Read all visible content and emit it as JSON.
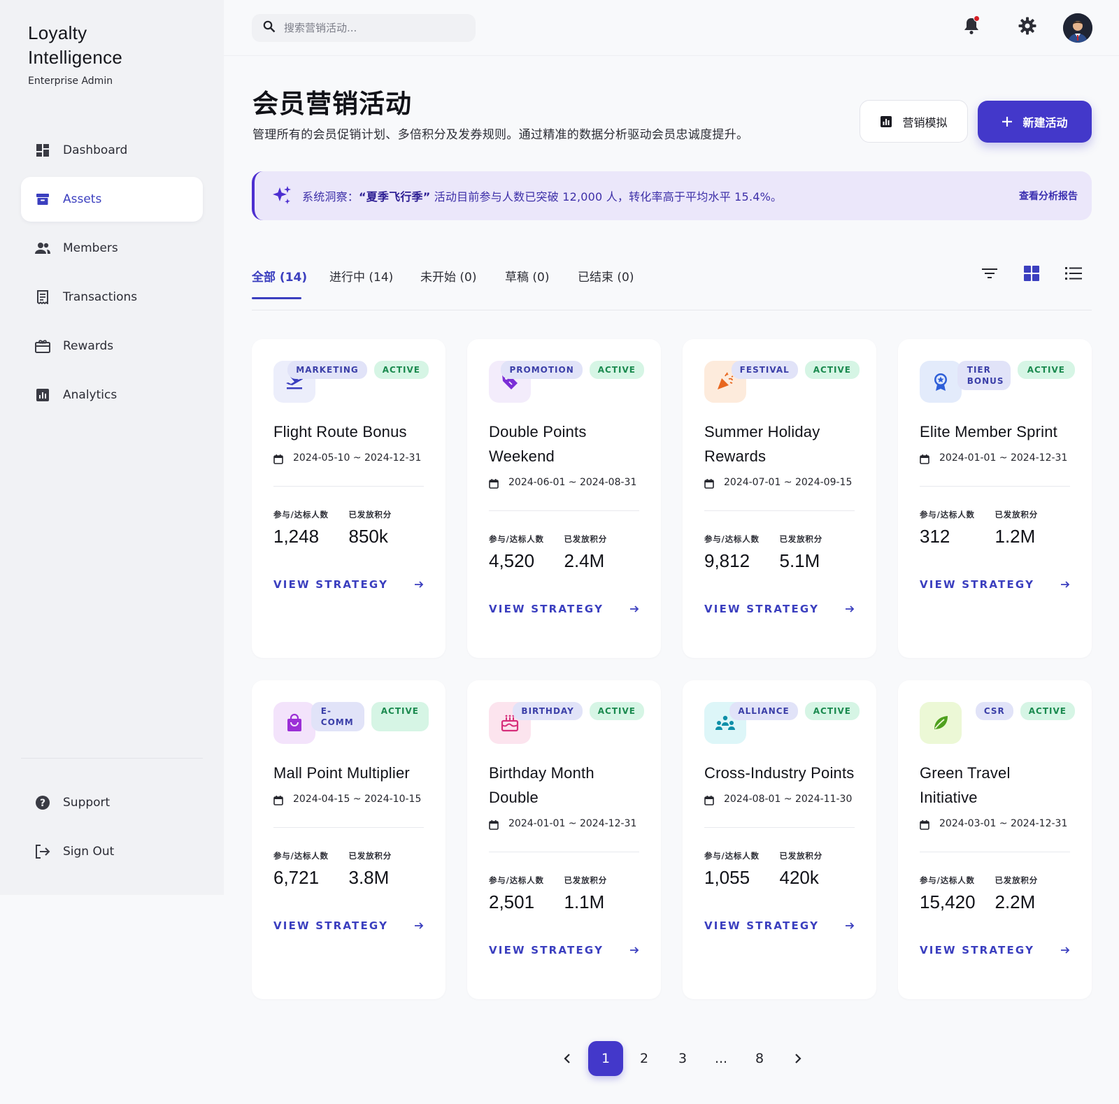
{
  "brand": {
    "title_line1": "Loyalty",
    "title_line2": "Intelligence",
    "subtitle": "Enterprise Admin"
  },
  "nav": {
    "items": [
      {
        "label": "Dashboard",
        "icon": "dashboard-icon"
      },
      {
        "label": "Assets",
        "icon": "archive-icon",
        "active": true
      },
      {
        "label": "Members",
        "icon": "people-icon"
      },
      {
        "label": "Transactions",
        "icon": "receipt-icon"
      },
      {
        "label": "Rewards",
        "icon": "gift-card-icon"
      },
      {
        "label": "Analytics",
        "icon": "bar-chart-icon"
      }
    ],
    "bottom": [
      {
        "label": "Support",
        "icon": "help-icon"
      },
      {
        "label": "Sign Out",
        "icon": "logout-icon"
      }
    ]
  },
  "topbar": {
    "search_placeholder": "搜索营销活动..."
  },
  "header": {
    "title": "会员营销活动",
    "subtitle": "管理所有的会员促销计划、多倍积分及发券规则。通过精准的数据分析驱动会员忠诚度提升。",
    "sim_button": "营销模拟",
    "new_button": "新建活动"
  },
  "insight": {
    "prefix": "系统洞察：",
    "highlight": "“夏季飞行季”",
    "suffix": " 活动目前参与人数已突破 12,000 人，转化率高于平均水平 15.4%。",
    "link": "查看分析报告"
  },
  "tabs": [
    "全部 (14)",
    "进行中 (14)",
    "未开始 (0)",
    "草稿 (0)",
    "已结束 (0)"
  ],
  "stat_labels": {
    "participants": "参与/达标人数",
    "points": "已发放积分"
  },
  "view_strategy": "VIEW STRATEGY",
  "cards": [
    {
      "type": "MARKETING",
      "status": "ACTIVE",
      "title": "Flight Route Bonus",
      "date": "2024-05-10 ~ 2024-12-31",
      "participants": "1,248",
      "points": "850k",
      "icon": "flight-icon",
      "accent": "#3b3fbf"
    },
    {
      "type": "PROMOTION",
      "status": "ACTIVE",
      "title": "Double Points Weekend",
      "date": "2024-06-01 ~ 2024-08-31",
      "participants": "4,520",
      "points": "2.4M",
      "icon": "tag-icon",
      "accent": "#7b2fd6"
    },
    {
      "type": "FESTIVAL",
      "status": "ACTIVE",
      "title": "Summer Holiday Rewards",
      "date": "2024-07-01 ~ 2024-09-15",
      "participants": "9,812",
      "points": "5.1M",
      "icon": "celebration-icon",
      "accent": "#e8671f"
    },
    {
      "type": "TIER BONUS",
      "status": "ACTIVE",
      "title": "Elite Member Sprint",
      "date": "2024-01-01 ~ 2024-12-31",
      "participants": "312",
      "points": "1.2M",
      "icon": "award-icon",
      "accent": "#2f5fd8"
    },
    {
      "type": "E-COMM",
      "status": "ACTIVE",
      "title": "Mall Point Multiplier",
      "date": "2024-04-15 ~ 2024-10-15",
      "participants": "6,721",
      "points": "3.8M",
      "icon": "shopping-bag-icon",
      "accent": "#9b2fd6"
    },
    {
      "type": "BIRTHDAY",
      "status": "ACTIVE",
      "title": "Birthday Month Double",
      "date": "2024-01-01 ~ 2024-12-31",
      "participants": "2,501",
      "points": "1.1M",
      "icon": "cake-icon",
      "accent": "#d62f7b"
    },
    {
      "type": "ALLIANCE",
      "status": "ACTIVE",
      "title": "Cross-Industry Points",
      "date": "2024-08-01 ~ 2024-11-30",
      "participants": "1,055",
      "points": "420k",
      "icon": "group-icon",
      "accent": "#0e8fa8"
    },
    {
      "type": "CSR",
      "status": "ACTIVE",
      "title": "Green Travel Initiative",
      "date": "2024-03-01 ~ 2024-12-31",
      "participants": "15,420",
      "points": "2.2M",
      "icon": "leaf-icon",
      "accent": "#4fa01f"
    }
  ],
  "pagination": {
    "pages": [
      "1",
      "2",
      "3",
      "...",
      "8"
    ],
    "current": "1"
  }
}
